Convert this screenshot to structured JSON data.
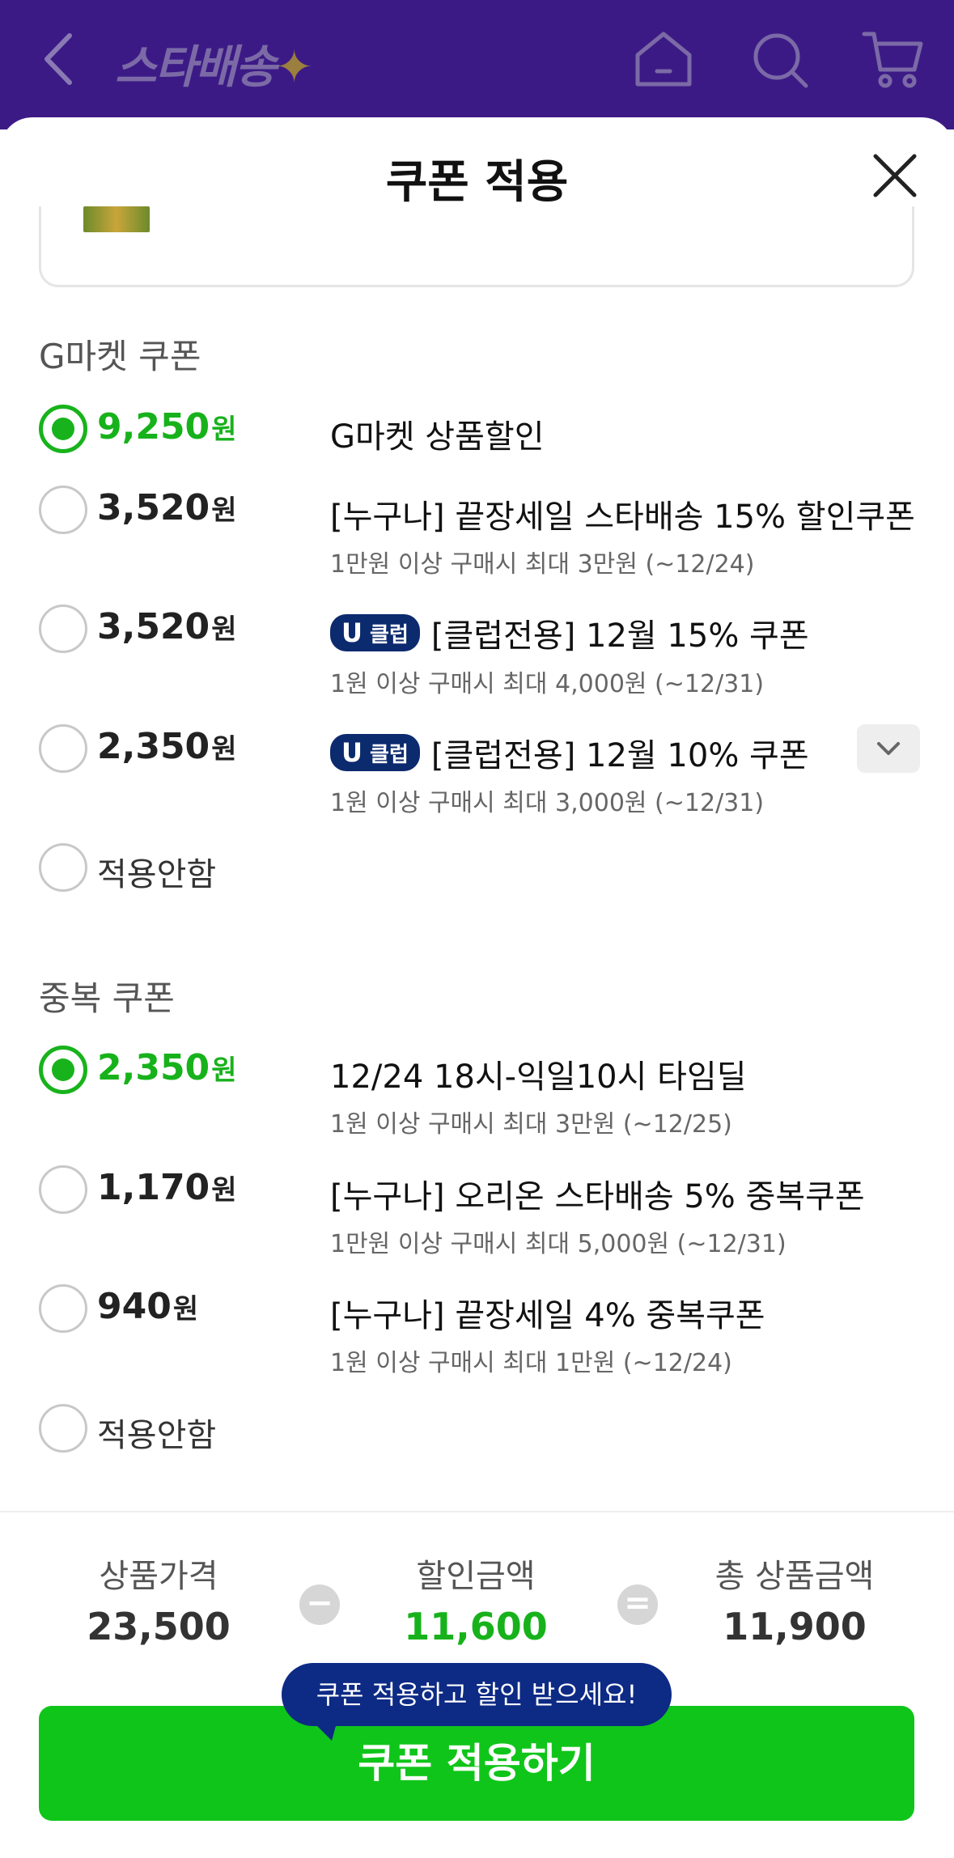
{
  "header": {
    "logo_text": "스타배송",
    "logo_star": "✦"
  },
  "sheet": {
    "title": "쿠폰 적용"
  },
  "gmarket_section": {
    "title": "G마켓 쿠폰",
    "coupons": [
      {
        "amount": "9,250",
        "unit": "원",
        "title": "G마켓 상품할인",
        "desc": "",
        "selected": true
      },
      {
        "amount": "3,520",
        "unit": "원",
        "title": "[누구나] 끝장세일 스타배송 15% 할인쿠폰",
        "desc": "1만원 이상 구매시 최대 3만원 (~12/24)",
        "selected": false
      },
      {
        "amount": "3,520",
        "unit": "원",
        "badge_u": "U",
        "badge_club": "클럽",
        "title": "[클럽전용] 12월 15% 쿠폰",
        "desc": "1원 이상 구매시 최대 4,000원 (~12/31)",
        "selected": false
      },
      {
        "amount": "2,350",
        "unit": "원",
        "badge_u": "U",
        "badge_club": "클럽",
        "title": "[클럽전용] 12월 10% 쿠폰",
        "desc": "1원 이상 구매시 최대 3,000원 (~12/31)",
        "selected": false
      }
    ],
    "no_apply": "적용안함"
  },
  "dup_section": {
    "title": "중복 쿠폰",
    "coupons": [
      {
        "amount": "2,350",
        "unit": "원",
        "title": "12/24 18시-익일10시 타임딜",
        "desc": "1원 이상 구매시 최대 3만원 (~12/25)",
        "selected": true
      },
      {
        "amount": "1,170",
        "unit": "원",
        "title": "[누구나] 오리온 스타배송 5% 중복쿠폰",
        "desc": "1만원 이상 구매시 최대 5,000원 (~12/31)",
        "selected": false
      },
      {
        "amount": "940",
        "unit": "원",
        "title": "[누구나] 끝장세일 4% 중복쿠폰",
        "desc": "1원 이상 구매시 최대 1만원 (~12/24)",
        "selected": false
      }
    ],
    "no_apply": "적용안함"
  },
  "summary": {
    "price_label": "상품가격",
    "price_value": "23,500",
    "minus": "−",
    "discount_label": "할인금액",
    "discount_value": "11,600",
    "equals": "=",
    "total_label": "총 상품금액",
    "total_value": "11,900"
  },
  "tooltip": "쿠폰 적용하고 할인 받으세요!",
  "apply_button": "쿠폰 적용하기",
  "colors": {
    "header_bg": "#3c1a86",
    "accent_green": "#17b21b",
    "button_green": "#10c51a",
    "club_badge": "#0c2a6e",
    "tooltip_bg": "#0d2a85"
  }
}
